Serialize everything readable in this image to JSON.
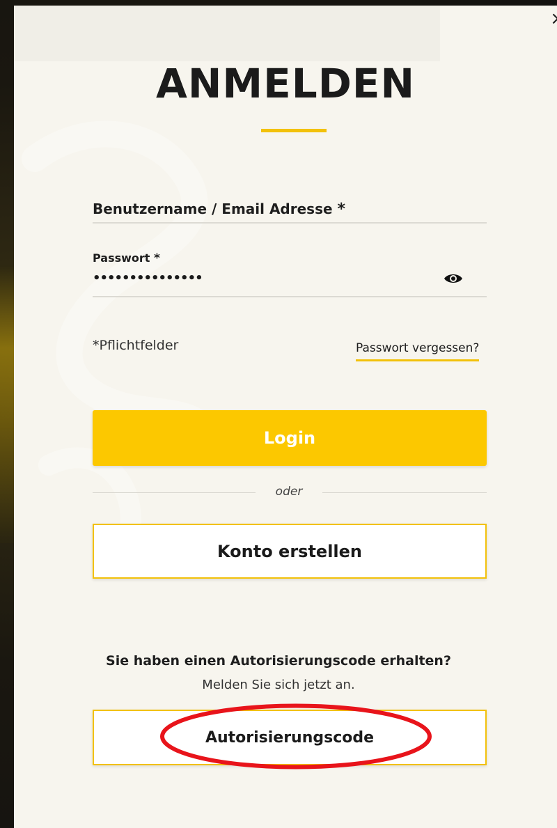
{
  "dialog": {
    "title": "ANMELDEN",
    "close_label": "×"
  },
  "form": {
    "username_label": "Benutzername / Email Adresse",
    "username_required": "*",
    "username_value": "",
    "password_label": "Passwort",
    "password_required": "*",
    "password_value": "•••••••••••••••",
    "show_password_icon": "eye-icon",
    "required_note": "*Pflichtfelder",
    "forgot_password_link": "Passwort vergessen?"
  },
  "actions": {
    "login_label": "Login",
    "divider_text": "oder",
    "create_account_label": "Konto erstellen"
  },
  "auth_code": {
    "heading": "Sie haben einen Autorisierungscode erhalten?",
    "subtext": "Melden Sie sich jetzt an.",
    "button_label": "Autorisierungscode"
  },
  "colors": {
    "accent": "#fcc800",
    "accent_border": "#f2c10a",
    "dialog_bg": "#f7f5ee",
    "annotation": "#e8141b"
  }
}
